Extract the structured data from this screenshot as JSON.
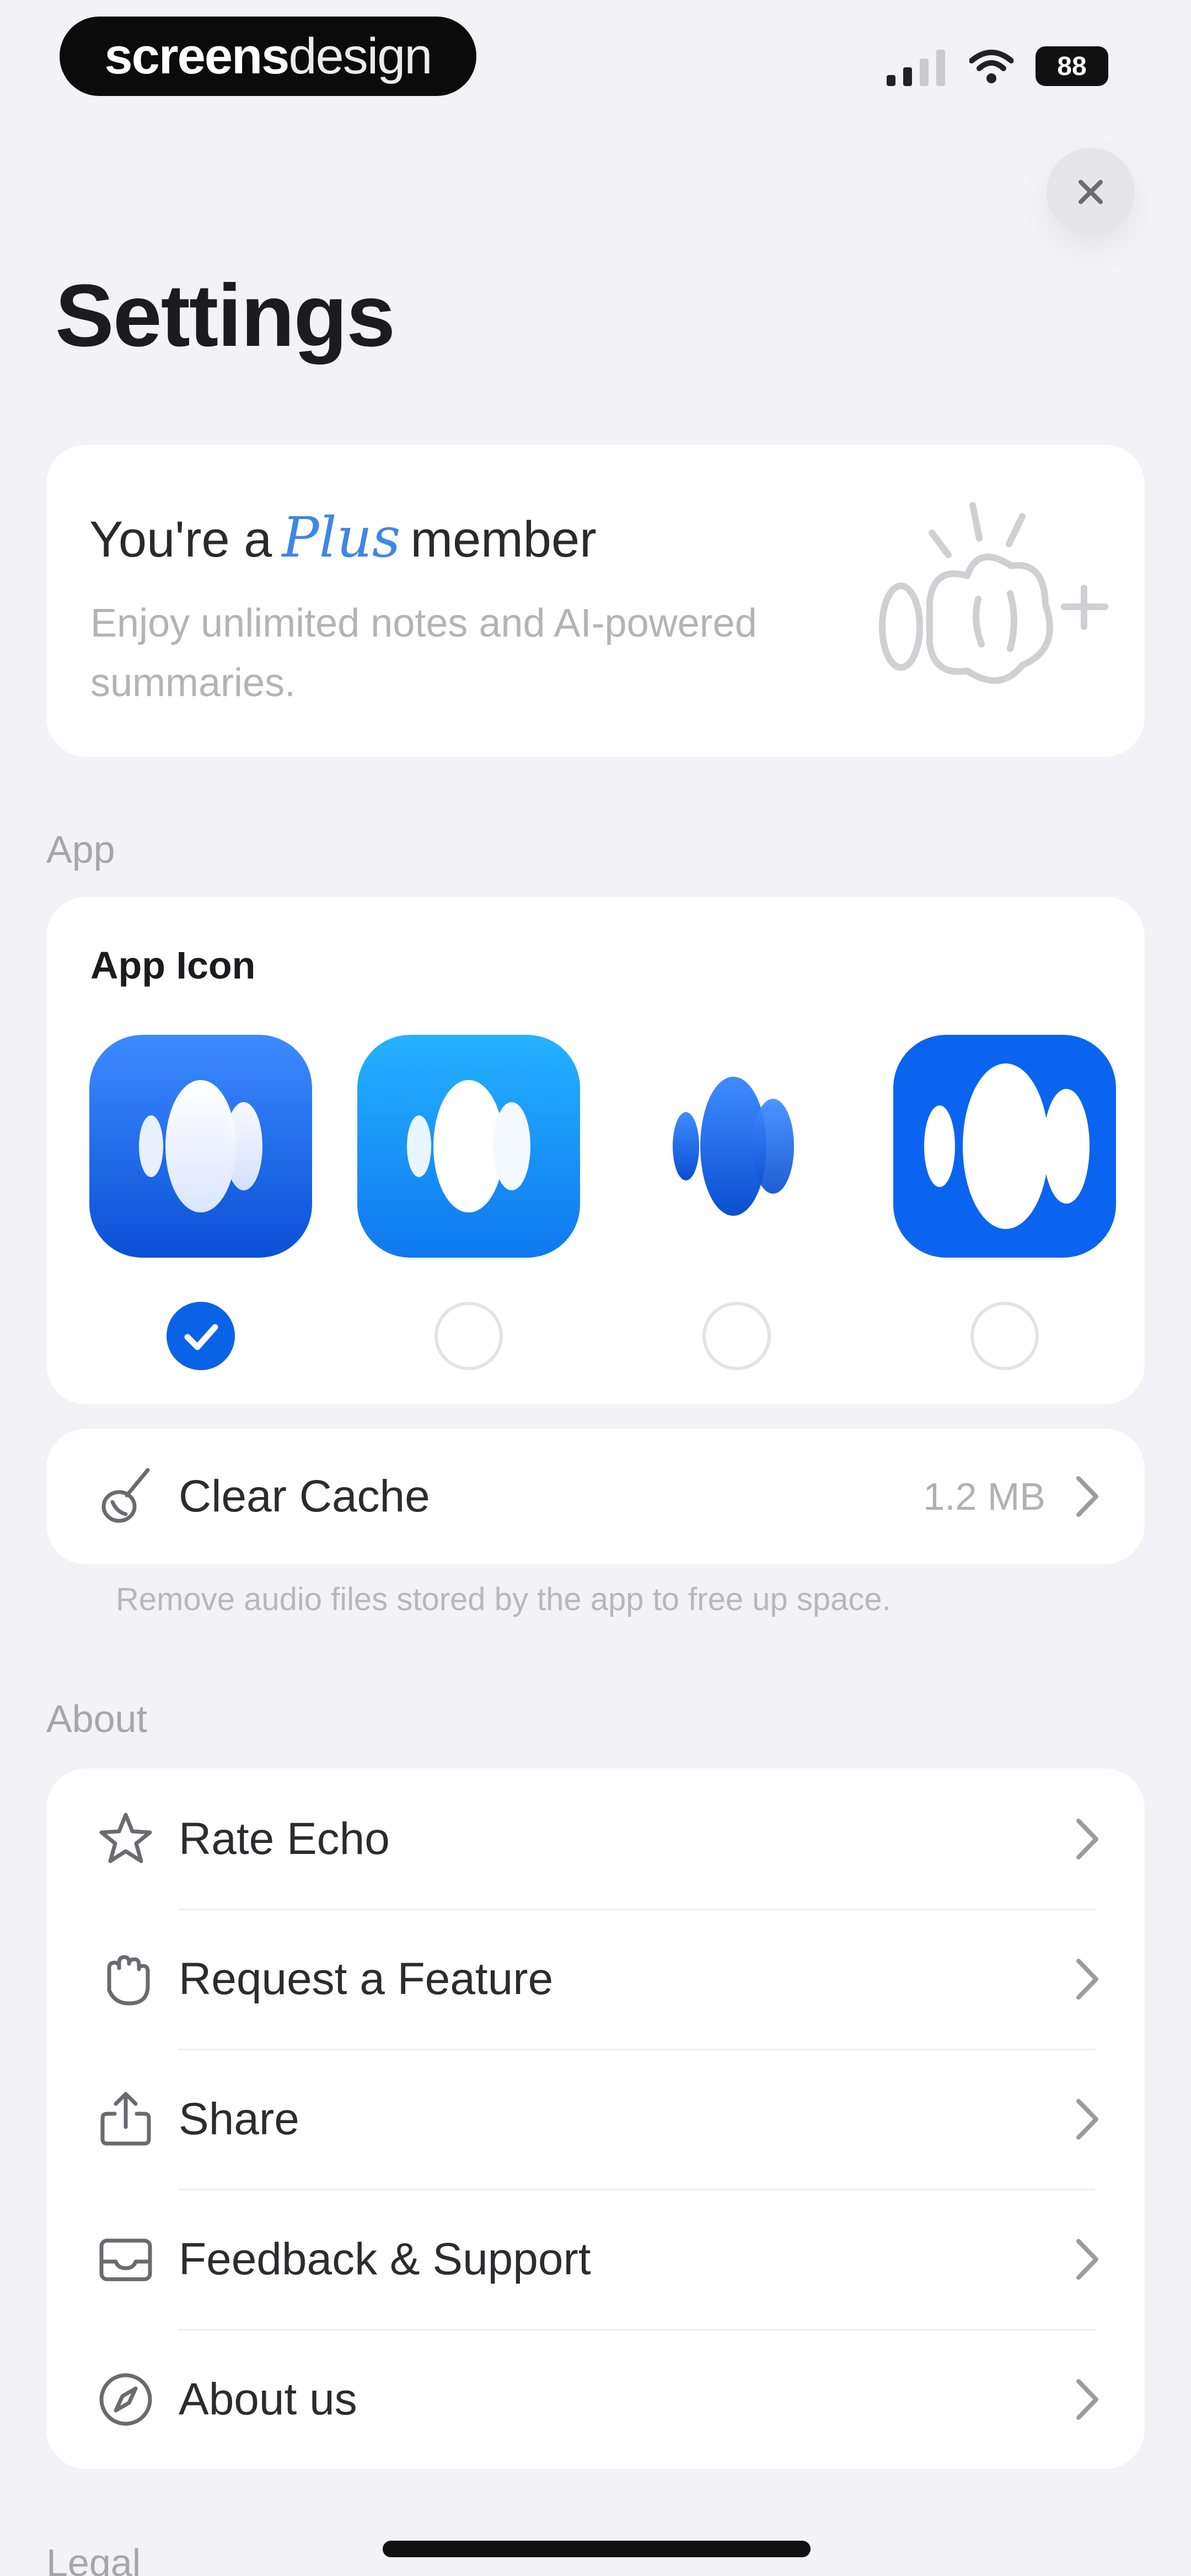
{
  "status_bar": {
    "brand_bold": "screens",
    "brand_light": "design",
    "battery": "88"
  },
  "header": {
    "title": "Settings",
    "close_icon": "close-icon"
  },
  "plus_card": {
    "prefix": "You're a",
    "plus_word": "Plus",
    "suffix": "member",
    "subtitle": "Enjoy unlimited notes and AI-powered summaries.",
    "illustration_icon": "sparkle-mascot-icon"
  },
  "sections": {
    "app": "App",
    "about": "About",
    "legal": "Legal"
  },
  "app_icon": {
    "title": "App Icon",
    "options": [
      {
        "name": "blue-gradient",
        "selected": true
      },
      {
        "name": "sky-blue",
        "selected": false
      },
      {
        "name": "transparent",
        "selected": false
      },
      {
        "name": "bold-blue",
        "selected": false
      }
    ]
  },
  "cache": {
    "label": "Clear Cache",
    "value": "1.2 MB",
    "hint": "Remove audio files stored by the app to free up space.",
    "icon": "broom-icon"
  },
  "about_items": [
    {
      "label": "Rate Echo",
      "icon": "star-icon"
    },
    {
      "label": "Request a Feature",
      "icon": "hand-icon"
    },
    {
      "label": "Share",
      "icon": "share-icon"
    },
    {
      "label": "Feedback & Support",
      "icon": "envelope-icon"
    },
    {
      "label": "About us",
      "icon": "compass-icon"
    }
  ],
  "colors": {
    "accent": "#0a63e6",
    "background": "#f2f2f7",
    "plus": "#3f86e6"
  }
}
